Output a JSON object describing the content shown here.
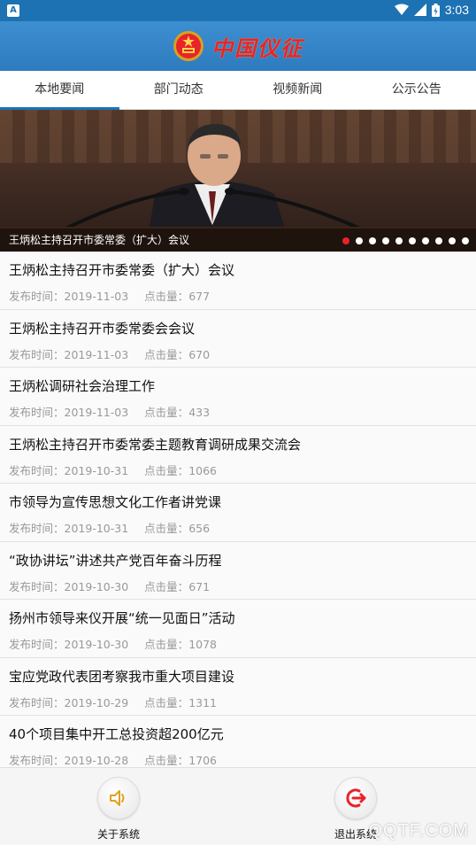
{
  "status_bar": {
    "time": "3:03",
    "app_icon": "A"
  },
  "header": {
    "title": "中国仪征",
    "emblem_icon": "national-emblem-icon"
  },
  "tabs": [
    {
      "label": "本地要闻",
      "active": true
    },
    {
      "label": "部门动态",
      "active": false
    },
    {
      "label": "视频新闻",
      "active": false
    },
    {
      "label": "公示公告",
      "active": false
    }
  ],
  "banner": {
    "caption": "王炳松主持召开市委常委（扩大）会议",
    "slide_count": 10,
    "active_slide": 1
  },
  "news": {
    "time_label": "发布时间：",
    "click_label": "点击量：",
    "items": [
      {
        "title": "王炳松主持召开市委常委（扩大）会议",
        "date": "2019-11-03",
        "clicks": "677"
      },
      {
        "title": "王炳松主持召开市委常委会会议",
        "date": "2019-11-03",
        "clicks": "670"
      },
      {
        "title": "王炳松调研社会治理工作",
        "date": "2019-11-03",
        "clicks": "433"
      },
      {
        "title": "王炳松主持召开市委常委主题教育调研成果交流会",
        "date": "2019-10-31",
        "clicks": "1066"
      },
      {
        "title": "市领导为宣传思想文化工作者讲党课",
        "date": "2019-10-31",
        "clicks": "656"
      },
      {
        "title": "“政协讲坛”讲述共产党百年奋斗历程",
        "date": "2019-10-30",
        "clicks": "671"
      },
      {
        "title": "扬州市领导来仪开展“统一见面日”活动",
        "date": "2019-10-30",
        "clicks": "1078"
      },
      {
        "title": "宝应党政代表团考察我市重大项目建设",
        "date": "2019-10-29",
        "clicks": "1311"
      },
      {
        "title": "40个项目集中开工总投资超200亿元",
        "date": "2019-10-28",
        "clicks": "1706"
      }
    ]
  },
  "bottom": {
    "about_label": "关于系统",
    "exit_label": "退出系统",
    "about_icon": "speaker-icon",
    "exit_icon": "logout-icon"
  },
  "watermark": "QQTF.COM",
  "colors": {
    "accent": "#1d72b3",
    "brand_red": "#e8232b",
    "meta_gray": "#999999"
  }
}
